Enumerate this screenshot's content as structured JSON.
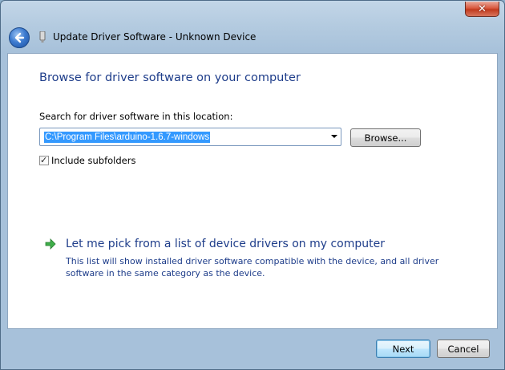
{
  "window": {
    "title": "Update Driver Software - Unknown Device",
    "close_symbol": "✕"
  },
  "main": {
    "heading": "Browse for driver software on your computer",
    "search_label": "Search for driver software in this location:",
    "path_value": "C:\\Program Files\\arduino-1.6.7-windows",
    "browse_label": "Browse...",
    "include_subfolders": {
      "label": "Include subfolders",
      "checked": true,
      "mark": "✓"
    }
  },
  "link": {
    "title": "Let me pick from a list of device drivers on my computer",
    "description": "This list will show installed driver software compatible with the device, and all driver software in the same category as the device."
  },
  "footer": {
    "next_label": "Next",
    "cancel_label": "Cancel"
  },
  "colors": {
    "accent": "#1e3d8a",
    "selection": "#3399ff"
  }
}
